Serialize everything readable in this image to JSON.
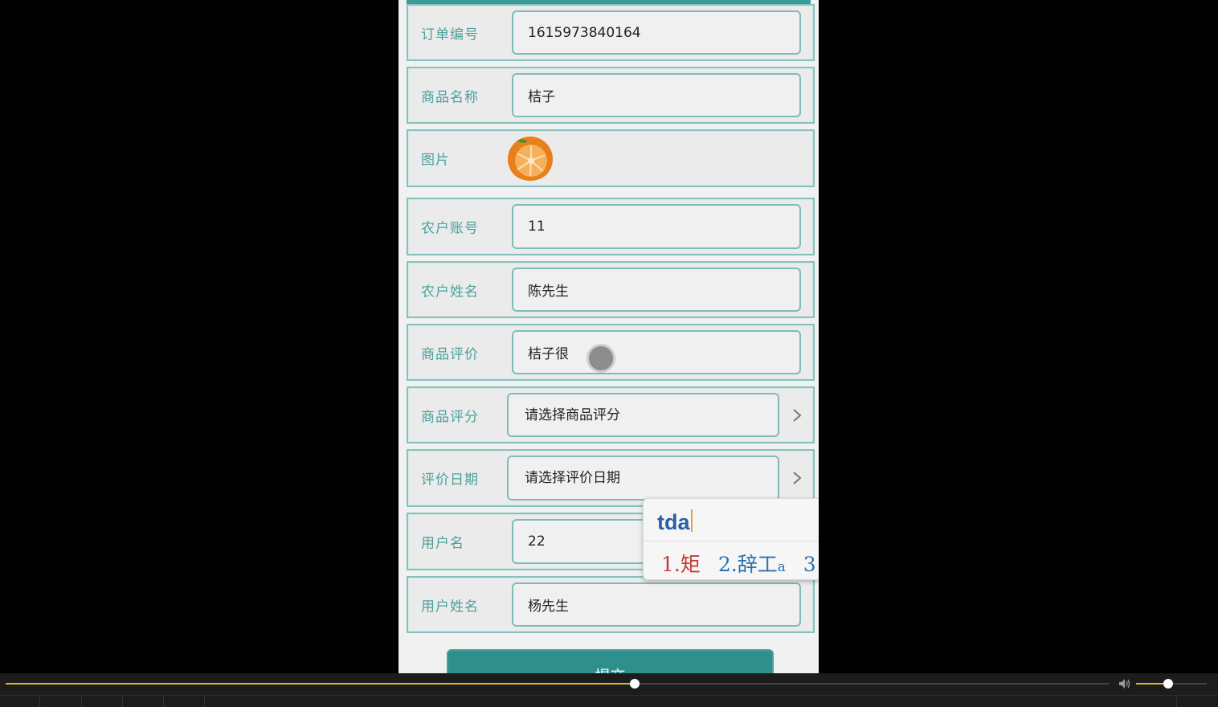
{
  "form": {
    "rows": [
      {
        "label": "订单编号",
        "value": "1615973840164",
        "placeholder": ""
      },
      {
        "label": "商品名称",
        "value": "桔子",
        "placeholder": ""
      },
      {
        "label": "图片",
        "image": "mandarin-orange-thumbnail"
      },
      {
        "label": "农户账号",
        "value": "11",
        "placeholder": ""
      },
      {
        "label": "农户姓名",
        "value": "陈先生",
        "placeholder": ""
      },
      {
        "label": "商品评价",
        "value": "桔子很",
        "placeholder": ""
      },
      {
        "label": "商品评分",
        "placeholder": "请选择商品评分",
        "icon": "chevron-right-icon"
      },
      {
        "label": "评价日期",
        "placeholder": "请选择评价日期",
        "icon": "chevron-right-icon"
      },
      {
        "label": "用户名",
        "value": "22",
        "placeholder": ""
      },
      {
        "label": "用户姓名",
        "value": "杨先生",
        "placeholder": ""
      }
    ],
    "submit_label": "提交"
  },
  "ime": {
    "composition": "tda",
    "candidates": [
      {
        "index": "1.",
        "text": "矩"
      },
      {
        "index": "2.",
        "text": "辞工",
        "sub": "a"
      },
      {
        "index": "3",
        "text": ""
      }
    ]
  },
  "player": {
    "progress": 0.57,
    "volume": 0.45
  },
  "colors": {
    "accent": "#3a9b96",
    "label": "#4aa19b",
    "border": "#86c2bd",
    "progress": "#e3b91c"
  }
}
